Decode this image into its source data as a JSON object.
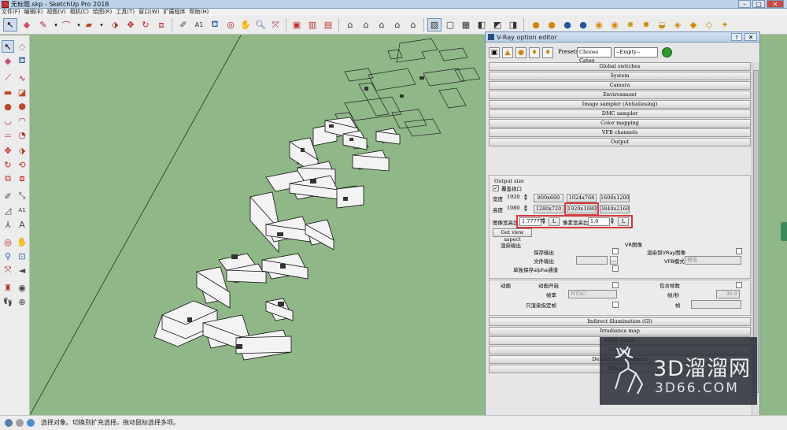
{
  "window": {
    "title": "无标题.skp - SketchUp Pro 2018"
  },
  "menu": [
    "文件(F)",
    "编辑(E)",
    "视图(V)",
    "相机(C)",
    "绘图(R)",
    "工具(T)",
    "窗口(W)",
    "扩展程序",
    "帮助(H)"
  ],
  "toolbar_icons": [
    "select-tool",
    "eraser-tool",
    "line-tool",
    "arc-tool",
    "rectangle-tool",
    "push-pull-tool",
    "move-tool",
    "rotate-tool",
    "offset-tool",
    "tape-measure-tool",
    "text-tool",
    "paint-bucket-tool",
    "orbit-tool",
    "pan-tool",
    "zoom-tool",
    "zoom-extents-tool",
    "warehouse-tool",
    "extension-warehouse-tool",
    "layout-tool",
    "standard-views",
    "iso-view",
    "top-view",
    "front-view",
    "right-view",
    "back-view",
    "left-view",
    "xray-style",
    "wireframe-style",
    "hidden-line-style",
    "shaded-style",
    "textured-style",
    "monochrome-style",
    "vray-render",
    "vray-options",
    "vray-frame-buffer",
    "vray-rt",
    "vray-light"
  ],
  "status": {
    "message": "选择对象。切换到扩充选择。拖动鼠标选择多项。"
  },
  "vray": {
    "title": "V-Ray option editor",
    "help_btn": "?",
    "close_btn": "✕",
    "presets_label": "Presets:",
    "presets_category": "Choose Categ",
    "presets_value": "--Empty--",
    "rollouts_top": [
      "Global switches",
      "System",
      "Camera",
      "Environment",
      "Image sampler (Antialiasing)",
      "DMC sampler",
      "Color mapping",
      "VFB channels",
      "Output"
    ],
    "output": {
      "section_label": "Output size",
      "override_label": "覆盖视口",
      "override_checked": true,
      "width_label": "宽度",
      "width_value": "1920",
      "height_label": "高度",
      "height_value": "1080",
      "presets": [
        "800x600",
        "1024x768",
        "1600x1200",
        "1280x720",
        "1920x1080",
        "3840x2160"
      ],
      "aspect_label": "图像宽高比",
      "aspect_value": "1.77777",
      "lock_btn": "L",
      "pixel_aspect_label": "像素宽高比",
      "pixel_aspect_value": "1.0",
      "get_view_aspect": "Get view aspect",
      "render_output_label": "渲染输出",
      "save_output_label": "保存输出",
      "file_output_label": "文件输出",
      "file_browse": "…",
      "save_alpha_label": "单独保存alpha通道",
      "vfb_label": "VR图像",
      "render_to_vray_image": "渲染到VRay图像",
      "vfb_mode_label": "VFB模式",
      "vfb_mode_value": "预览",
      "animation_label": "动画",
      "animation_on": "动画开启",
      "include_frame": "包含帧数",
      "frame_rate_label": "帧率",
      "frame_rate_value": "NTSC",
      "fps_label": "帧/秒",
      "fps_value": "30.0",
      "render_key_frames": "只渲染指定帧",
      "frames_label": "帧"
    },
    "rollouts_bottom": [
      "Indirect illumination (GI)",
      "Irradiance map",
      "Light cache",
      "Caustics",
      "Default displacement",
      "RTEngine"
    ]
  },
  "watermark": {
    "line1": "3D溜溜网",
    "line2": "3D66.COM"
  },
  "colors": {
    "ground": "#8fb787",
    "highlight": "#d8373b",
    "titlebar": "#bcd3ea"
  }
}
